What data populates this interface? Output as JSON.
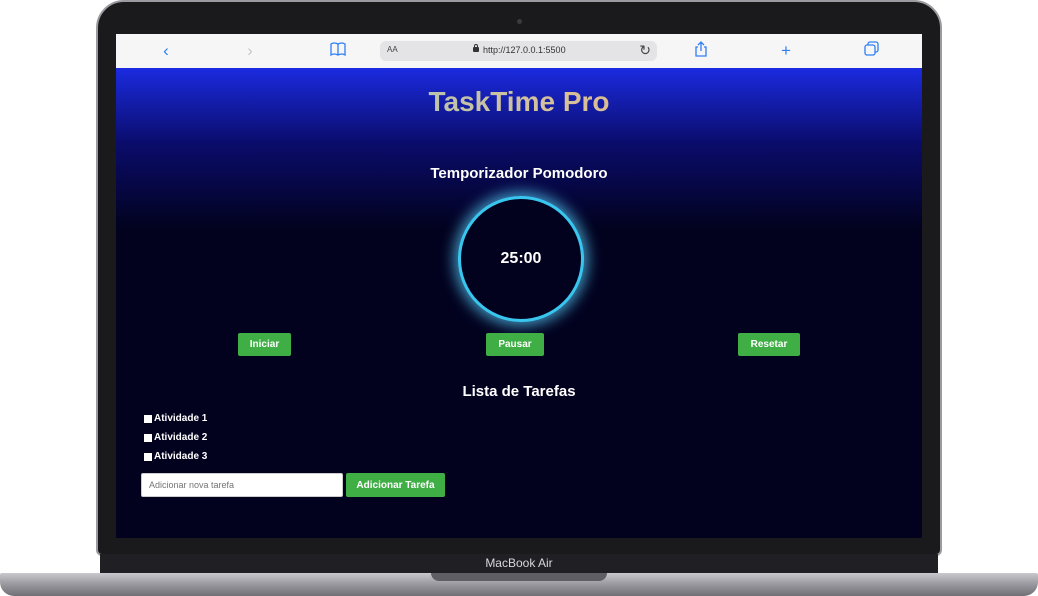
{
  "device": {
    "label": "MacBook Air"
  },
  "browser": {
    "text_size_label": "AA",
    "url": "http://127.0.0.1:5500",
    "icons": {
      "back": "chevron-left-icon",
      "forward": "chevron-right-icon",
      "bookmarks": "book-icon",
      "reload": "reload-icon",
      "share": "share-icon",
      "new_tab": "plus-icon",
      "tabs": "tabs-icon"
    }
  },
  "app": {
    "logo": "TaskTime Pro",
    "timer": {
      "title": "Temporizador Pomodoro",
      "display": "25:00"
    },
    "controls": {
      "start": "Iniciar",
      "pause": "Pausar",
      "reset": "Resetar"
    },
    "tasks": {
      "title": "Lista de Tarefas",
      "items": [
        {
          "label": "Atividade 1",
          "checked": false
        },
        {
          "label": "Atividade 2",
          "checked": false
        },
        {
          "label": "Atividade 3",
          "checked": false
        }
      ],
      "input_placeholder": "Adicionar nova tarefa",
      "add_label": "Adicionar Tarefa"
    }
  },
  "colors": {
    "accent_green": "#3fae45",
    "timer_ring": "#38c6ef",
    "page_background": "#02021f",
    "header_blue": "#1b2be0"
  }
}
